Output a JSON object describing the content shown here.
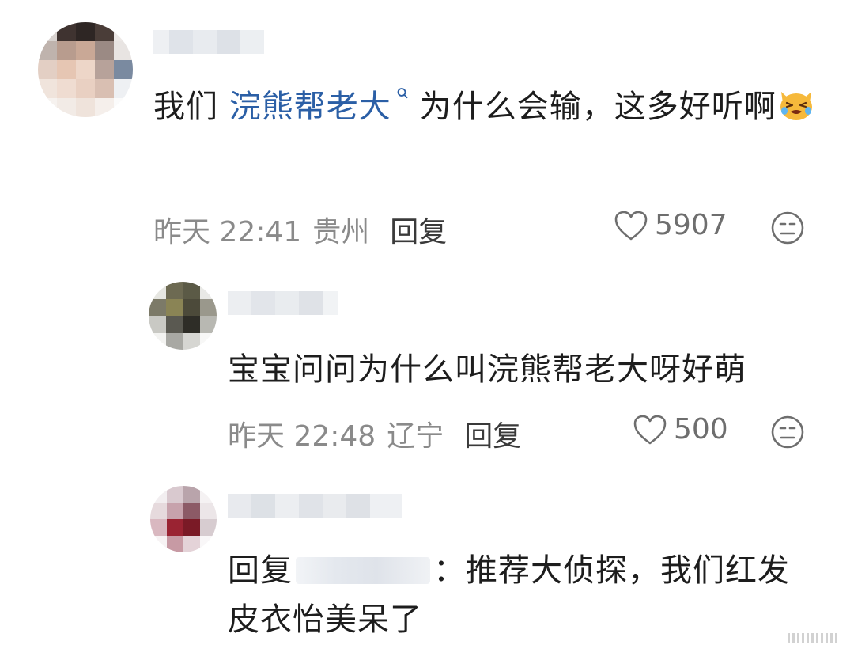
{
  "comments": [
    {
      "text_before": "我们 ",
      "mention": "浣熊帮老大",
      "text_after": "为什么会输，这多好听啊",
      "time": "昨天 22:41",
      "location": "贵州",
      "reply_label": "回复",
      "likes": "5907"
    },
    {
      "text": "宝宝问问为什么叫浣熊帮老大呀好萌",
      "time": "昨天 22:48",
      "location": "辽宁",
      "reply_label": "回复",
      "likes": "500"
    },
    {
      "reply_prefix": "回复",
      "text": "：推荐大侦探，我们红发皮衣怡美呆了"
    }
  ],
  "colors": {
    "mention": "#2b5fa6",
    "meta": "#8a8a8a",
    "text": "#1d1d1d"
  },
  "icons": {
    "mention_suffix": "search-icon",
    "emoji": "crying-cat-emoji",
    "like": "heart-outline-icon",
    "dislike": "neutral-face-icon"
  }
}
